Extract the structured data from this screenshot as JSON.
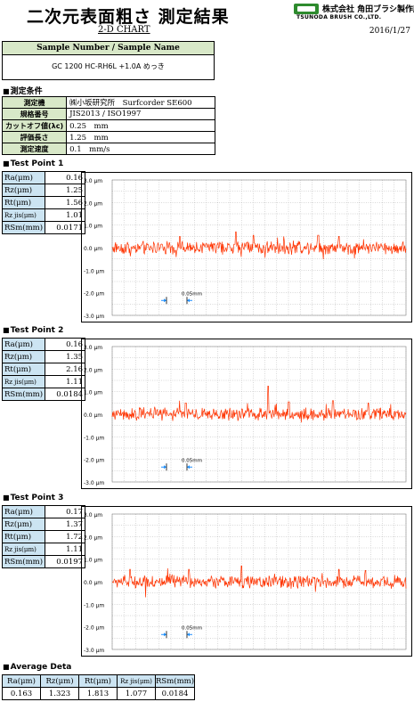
{
  "header": {
    "title": "二次元表面粗さ 測定結果",
    "subtitle": "2-D CHART",
    "date": "2016/1/27",
    "company_jp": "株式会社 角田ブラシ製作所",
    "company_en": "TSUNODA BRUSH CO.,LTD."
  },
  "sample": {
    "header": "Sample Number / Sample Name",
    "value": "GC 1200 HC-RH6L +1.0A めっき"
  },
  "conditions": {
    "section": "測定条件",
    "rows": [
      {
        "label": "測定機",
        "value": "㈱小坂研究所　Surfcorder SE600"
      },
      {
        "label": "規格番号",
        "value": "JIS2013 / ISO1997"
      },
      {
        "label": "カットオフ値(λc)",
        "value": "0.25　mm"
      },
      {
        "label": "評価長さ",
        "value": "1.25　mm"
      },
      {
        "label": "測定速度",
        "value": "0.1　mm/s"
      }
    ]
  },
  "param_labels": [
    "Ra(μm)",
    "Rz(μm)",
    "Rt(μm)",
    "Rz jis(μm)",
    "RSm(mm)"
  ],
  "points": [
    {
      "section": "Test Point 1",
      "values": [
        "0.16",
        "1.25",
        "1.56",
        "1.01",
        "0.0171"
      ]
    },
    {
      "section": "Test Point 2",
      "values": [
        "0.16",
        "1.35",
        "2.16",
        "1.11",
        "0.0184"
      ]
    },
    {
      "section": "Test Point 3",
      "values": [
        "0.17",
        "1.37",
        "1.72",
        "1.11",
        "0.0197"
      ]
    }
  ],
  "chart_common": {
    "y_ticks": [
      "3.0 μm",
      "2.0 μm",
      "1.0 μm",
      "0.0 μm",
      "-1.0 μm",
      "-2.0 μm",
      "-3.0 μm"
    ],
    "scale_label": "0.05mm",
    "colors": {
      "trace": "#ff3300",
      "grid": "#b0b0b0",
      "scale": "#1e90ff"
    }
  },
  "chart_data": [
    {
      "type": "line",
      "series": [
        {
          "values": []
        }
      ],
      "ylim": [
        -3.0,
        3.0
      ],
      "grid": true
    },
    {
      "type": "line",
      "series": [
        {
          "values": []
        }
      ],
      "ylim": [
        -3.0,
        3.0
      ],
      "grid": true
    },
    {
      "type": "line",
      "series": [
        {
          "values": []
        }
      ],
      "ylim": [
        -3.0,
        3.0
      ],
      "grid": true
    }
  ],
  "average": {
    "section": "Average Deta",
    "labels": [
      "Ra(μm)",
      "Rz(μm)",
      "Rt(μm)",
      "Rz jis(μm)",
      "RSm(mm)"
    ],
    "values": [
      "0.163",
      "1.323",
      "1.813",
      "1.077",
      "0.0184"
    ]
  }
}
